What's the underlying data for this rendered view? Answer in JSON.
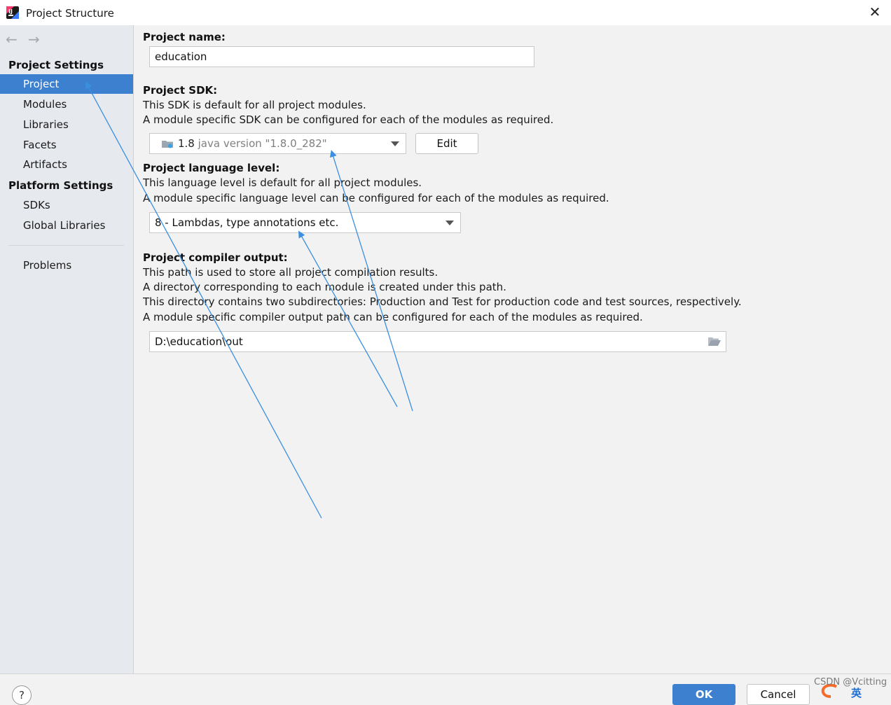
{
  "window": {
    "title": "Project Structure",
    "close_icon": "close-icon",
    "app_icon": "intellij-idea-icon"
  },
  "navigation": {
    "back_icon": "arrow-left-icon",
    "forward_icon": "arrow-right-icon",
    "back_glyph": "←",
    "forward_glyph": "→"
  },
  "sidebar": {
    "project_settings_header": "Project Settings",
    "project_items": [
      {
        "label": "Project",
        "selected": true
      },
      {
        "label": "Modules",
        "selected": false
      },
      {
        "label": "Libraries",
        "selected": false
      },
      {
        "label": "Facets",
        "selected": false
      },
      {
        "label": "Artifacts",
        "selected": false
      }
    ],
    "platform_settings_header": "Platform Settings",
    "platform_items": [
      {
        "label": "SDKs"
      },
      {
        "label": "Global Libraries"
      }
    ],
    "problems": "Problems"
  },
  "project_name": {
    "label": "Project name:",
    "value": "education"
  },
  "project_sdk": {
    "label": "Project SDK:",
    "desc_line1": "This SDK is default for all project modules.",
    "desc_line2": "A module specific SDK can be configured for each of the modules as required.",
    "selected_version": "1.8",
    "selected_desc": "java version \"1.8.0_282\"",
    "edit_button": "Edit"
  },
  "language_level": {
    "label": "Project language level:",
    "desc_line1": "This language level is default for all project modules.",
    "desc_line2": "A module specific language level can be configured for each of the modules as required.",
    "selected": "8 - Lambdas, type annotations etc."
  },
  "compiler_output": {
    "label": "Project compiler output:",
    "desc_line1": "This path is used to store all project compilation results.",
    "desc_line2": "A directory corresponding to each module is created under this path.",
    "desc_line3": "This directory contains two subdirectories: Production and Test for production code and test sources, respectively.",
    "desc_line4": "A module specific compiler output path can be configured for each of the modules as required.",
    "path": "D:\\education\\out"
  },
  "footer": {
    "help": "?",
    "ok": "OK",
    "cancel": "Cancel",
    "watermark": "CSDN @Vcitting",
    "tray_glyph": "英"
  },
  "colors": {
    "selection": "#3c80cf",
    "annotation_arrow": "#3b8fe0",
    "sidebar_bg": "#e6e9ee",
    "panel_bg": "#f2f2f2"
  }
}
